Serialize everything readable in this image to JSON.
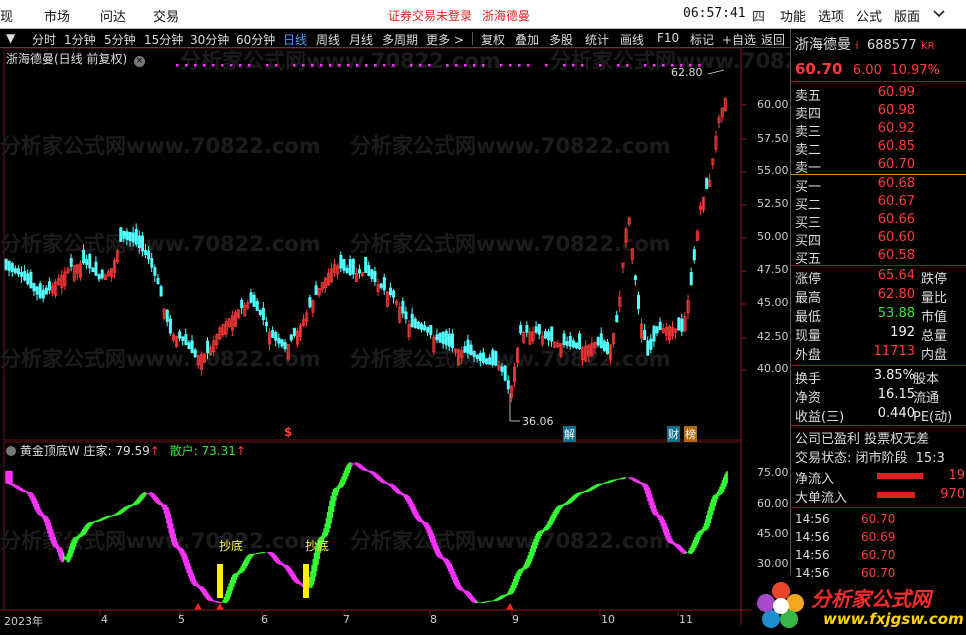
{
  "menu": {
    "items": [
      "现",
      "市场",
      "问达",
      "交易"
    ],
    "notice": "证券交易未登录",
    "stock_notice": "浙海德曼",
    "clock": "06:57:41",
    "sys_items": [
      "四",
      "功能",
      "选项",
      "公式",
      "版面"
    ]
  },
  "toolbar": {
    "periods": [
      "分时",
      "1分钟",
      "5分钟",
      "15分钟",
      "30分钟",
      "60分钟",
      "日线",
      "周线",
      "月线",
      "多周期",
      "更多 >"
    ],
    "active": "日线",
    "actions": [
      "复权",
      "叠加",
      "多股",
      "统计",
      "画线",
      "F10",
      "标记",
      "+自选",
      "返回"
    ]
  },
  "chart": {
    "title": "浙海德曼(日线 前复权)",
    "high_label": "62.80",
    "low_label": "36.06",
    "y_ticks": [
      "60.00",
      "57.50",
      "55.00",
      "52.50",
      "50.00",
      "47.50",
      "45.00",
      "42.50",
      "40.00"
    ],
    "markers": [
      "$",
      "解",
      "财",
      "榜"
    ],
    "watermark": "分析家公式网www.70822.com"
  },
  "indicator": {
    "name": "黄金顶底W",
    "zhuangjia_label": "庄家:",
    "zhuangjia_value": "79.59",
    "sanhu_label": "散户:",
    "sanhu_value": "73.31",
    "signal_label": "抄底",
    "y_ticks": [
      "75.00",
      "60.00",
      "45.00",
      "30.00"
    ]
  },
  "x_axis": [
    "2023年",
    "4",
    "5",
    "6",
    "7",
    "8",
    "9",
    "10",
    "11"
  ],
  "quote": {
    "name": "浙海德曼",
    "mark": "i",
    "code": "688577",
    "tag": "KR",
    "price": "60.70",
    "change": "6.00",
    "pct": "10.97%",
    "asks": [
      {
        "label": "卖五",
        "price": "60.99"
      },
      {
        "label": "卖四",
        "price": "60.98"
      },
      {
        "label": "卖三",
        "price": "60.92"
      },
      {
        "label": "卖二",
        "price": "60.85"
      },
      {
        "label": "卖一",
        "price": "60.70"
      }
    ],
    "bids": [
      {
        "label": "买一",
        "price": "60.68"
      },
      {
        "label": "买二",
        "price": "60.67"
      },
      {
        "label": "买三",
        "price": "60.66"
      },
      {
        "label": "买四",
        "price": "60.60"
      },
      {
        "label": "买五",
        "price": "60.58"
      }
    ],
    "stats": [
      {
        "label": "涨停",
        "value": "65.64",
        "color": "#ff3b3b",
        "label2": "跌停"
      },
      {
        "label": "最高",
        "value": "62.80",
        "color": "#ff3b3b",
        "label2": "量比"
      },
      {
        "label": "最低",
        "value": "53.88",
        "color": "#2ee62e",
        "label2": "市值"
      },
      {
        "label": "现量",
        "value": "192",
        "color": "#f2f2f2",
        "label2": "总量"
      },
      {
        "label": "外盘",
        "value": "11713",
        "color": "#ff3b3b",
        "label2": "内盘"
      }
    ],
    "stats2": [
      {
        "label": "换手",
        "value": "3.85%",
        "label2": "股本"
      },
      {
        "label": "净资",
        "value": "16.15",
        "label2": "流通"
      },
      {
        "label": "收益(三)",
        "value": "0.440",
        "label2": "PE(动)"
      }
    ],
    "info1": "公司已盈利 投票权无差",
    "info2": "交易状态: 闭市阶段",
    "info2_time": "15:3",
    "flows": [
      {
        "label": "净流入",
        "value": "19"
      },
      {
        "label": "大单流入",
        "value": "970"
      }
    ],
    "ticks": [
      {
        "time": "14:56",
        "price": "60.70"
      },
      {
        "time": "14:56",
        "price": "60.69"
      },
      {
        "time": "14:56",
        "price": "60.70"
      },
      {
        "time": "14:56",
        "price": "60.70"
      }
    ]
  },
  "logo": {
    "name": "分析家公式网",
    "url": "www.fxjgsw.com"
  }
}
